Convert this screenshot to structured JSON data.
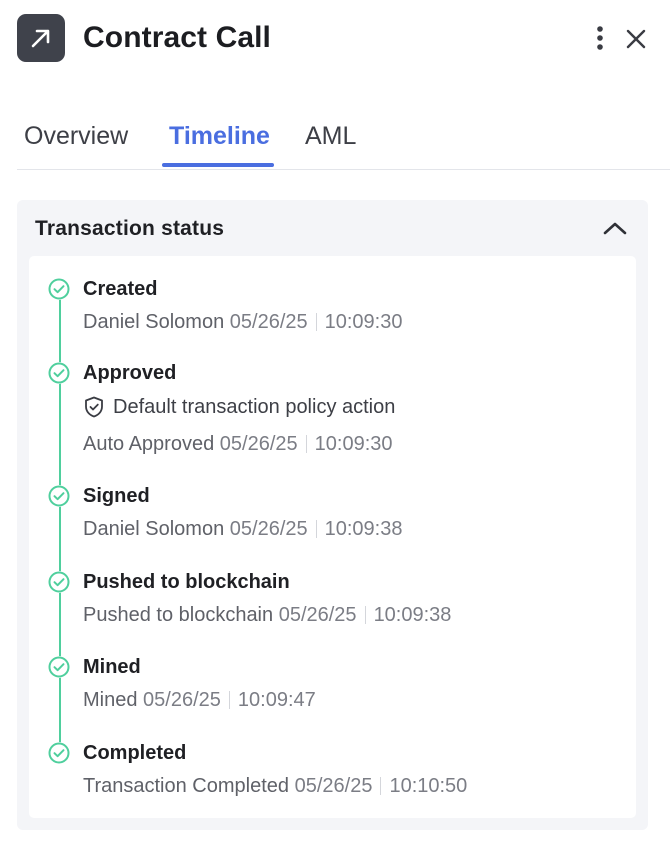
{
  "header": {
    "title": "Contract Call",
    "icon": "arrow-up-right-icon",
    "more_icon": "more-vertical-icon",
    "close_icon": "close-icon"
  },
  "tabs": [
    {
      "label": "Overview",
      "active": false
    },
    {
      "label": "Timeline",
      "active": true
    },
    {
      "label": "AML",
      "active": false
    }
  ],
  "status_card": {
    "title": "Transaction status",
    "collapse_icon": "chevron-up-icon",
    "steps": [
      {
        "title": "Created",
        "by": "Daniel Solomon",
        "date": "05/26/25",
        "time": "10:09:30"
      },
      {
        "title": "Approved",
        "policy": "Default transaction policy action",
        "by": "Auto Approved",
        "date": "05/26/25",
        "time": "10:09:30"
      },
      {
        "title": "Signed",
        "by": "Daniel Solomon",
        "date": "05/26/25",
        "time": "10:09:38"
      },
      {
        "title": "Pushed to blockchain",
        "by": "Pushed to blockchain",
        "date": "05/26/25",
        "time": "10:09:38"
      },
      {
        "title": "Mined",
        "by": "Mined",
        "date": "05/26/25",
        "time": "10:09:47"
      },
      {
        "title": "Completed",
        "by": "Transaction Completed",
        "date": "05/26/25",
        "time": "10:10:50"
      }
    ]
  },
  "colors": {
    "accent": "#4a6ee0",
    "success": "#4fcf9d",
    "icon_tile": "#3f424b"
  }
}
